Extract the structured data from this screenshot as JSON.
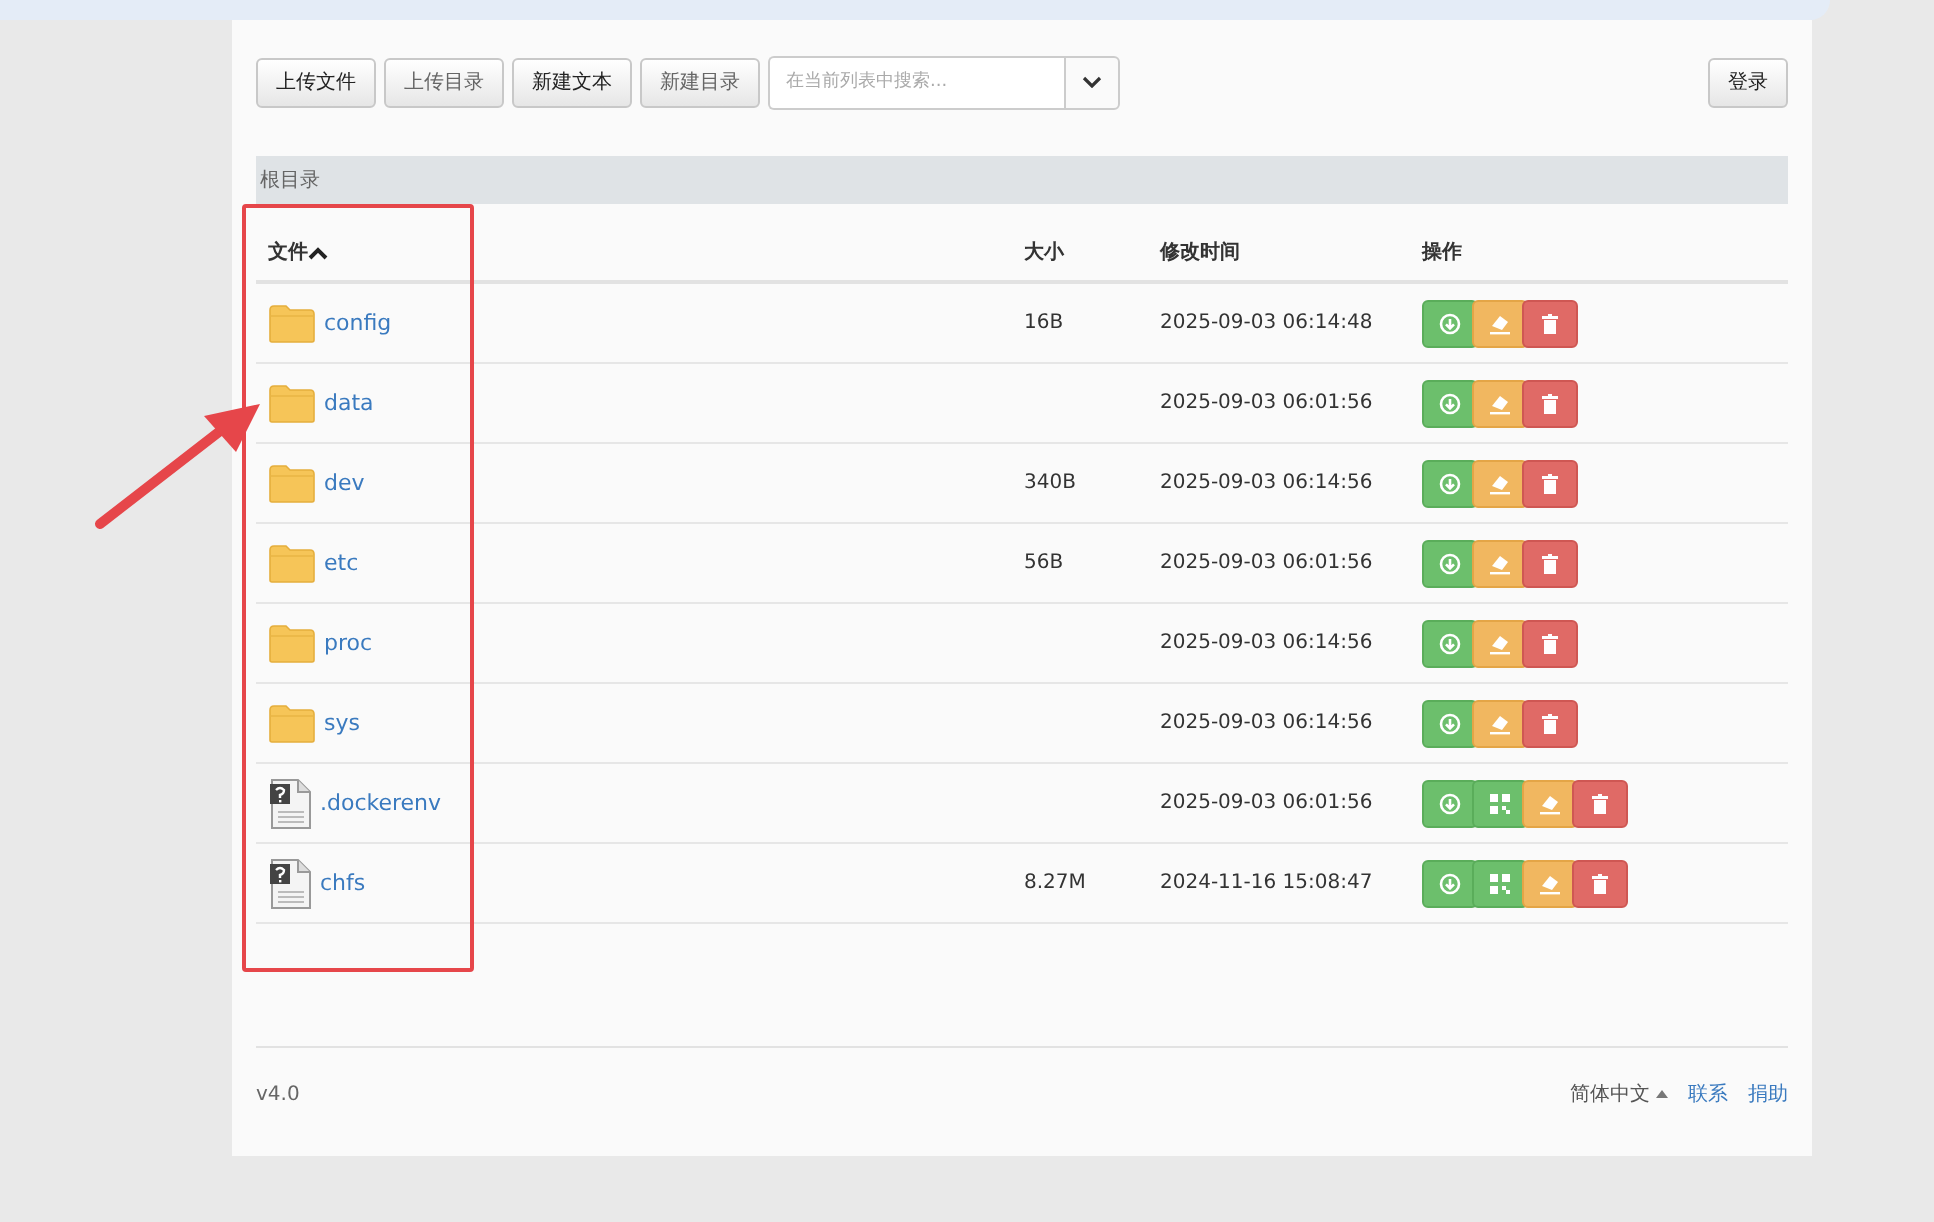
{
  "toolbar": {
    "buttons": [
      {
        "label": "上传文件",
        "disabled": false
      },
      {
        "label": "上传目录",
        "disabled": true
      },
      {
        "label": "新建文本",
        "disabled": false
      },
      {
        "label": "新建目录",
        "disabled": true
      }
    ],
    "search": {
      "placeholder": "在当前列表中搜索..."
    },
    "login": "登录"
  },
  "breadcrumb": "根目录",
  "table": {
    "columns": [
      {
        "label": "文件",
        "sorted": true
      },
      {
        "label": "大小",
        "sorted": false
      },
      {
        "label": "修改时间",
        "sorted": false
      },
      {
        "label": "操作",
        "sorted": false
      }
    ],
    "rows": [
      {
        "kind": "folder",
        "name": "config",
        "size": "16B",
        "modified": "2025-09-03 06:14:48",
        "actions": [
          {
            "kind": "download"
          },
          {
            "kind": "edit"
          },
          {
            "kind": "delete"
          }
        ]
      },
      {
        "kind": "folder",
        "name": "data",
        "modified": "2025-09-03 06:01:56",
        "actions": [
          {
            "kind": "download"
          },
          {
            "kind": "edit"
          },
          {
            "kind": "delete"
          }
        ]
      },
      {
        "kind": "folder",
        "name": "dev",
        "size": "340B",
        "modified": "2025-09-03 06:14:56",
        "actions": [
          {
            "kind": "download"
          },
          {
            "kind": "edit"
          },
          {
            "kind": "delete"
          }
        ]
      },
      {
        "kind": "folder",
        "name": "etc",
        "size": "56B",
        "modified": "2025-09-03 06:01:56",
        "actions": [
          {
            "kind": "download"
          },
          {
            "kind": "edit"
          },
          {
            "kind": "delete"
          }
        ]
      },
      {
        "kind": "folder",
        "name": "proc",
        "modified": "2025-09-03 06:14:56",
        "actions": [
          {
            "kind": "download"
          },
          {
            "kind": "edit"
          },
          {
            "kind": "delete"
          }
        ]
      },
      {
        "kind": "folder",
        "name": "sys",
        "modified": "2025-09-03 06:14:56",
        "actions": [
          {
            "kind": "download"
          },
          {
            "kind": "edit"
          },
          {
            "kind": "delete"
          }
        ]
      },
      {
        "kind": "file",
        "name": ".dockerenv",
        "modified": "2025-09-03 06:01:56",
        "actions": [
          {
            "kind": "download"
          },
          {
            "kind": "qrcode"
          },
          {
            "kind": "edit"
          },
          {
            "kind": "delete"
          }
        ]
      },
      {
        "kind": "file",
        "name": "chfs",
        "size": "8.27M",
        "modified": "2024-11-16 15:08:47",
        "actions": [
          {
            "kind": "download"
          },
          {
            "kind": "qrcode"
          },
          {
            "kind": "edit"
          },
          {
            "kind": "delete"
          }
        ]
      }
    ]
  },
  "footer": {
    "version": "v4.0",
    "language": "简体中文",
    "links": [
      "联系",
      "捐助"
    ]
  }
}
